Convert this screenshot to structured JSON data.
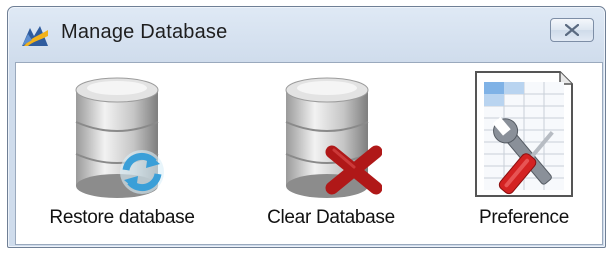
{
  "window": {
    "title": "Manage Database",
    "icons": {
      "app": "app-logo-icon",
      "close": "close-icon"
    }
  },
  "tools": [
    {
      "label": "Restore database",
      "icon": "database-restore-icon"
    },
    {
      "label": "Clear Database",
      "icon": "database-clear-icon"
    },
    {
      "label": "Preference",
      "icon": "preference-tools-icon"
    }
  ],
  "colors": {
    "title_bar": "#dfe9f5",
    "restore_arrows": "#3a9fd8",
    "clear_x": "#b01818",
    "wrench": "#8a9099",
    "screwdriver_handle": "#d42222"
  }
}
